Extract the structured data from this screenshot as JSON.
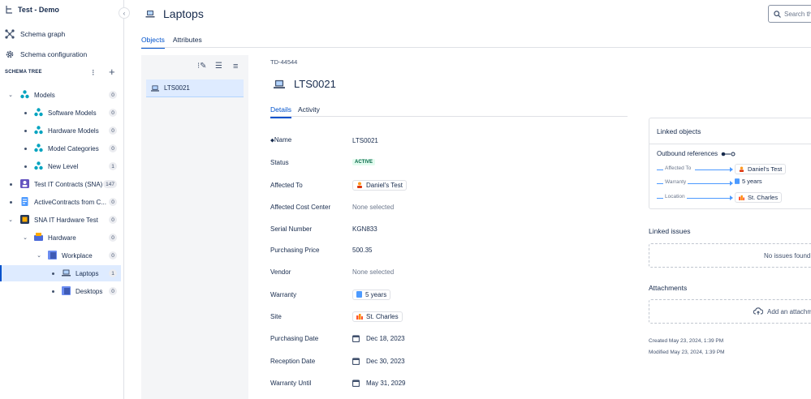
{
  "sidebar": {
    "title": "Test - Demo",
    "nav": [
      {
        "label": "Schema graph",
        "icon": "schema-graph-icon"
      },
      {
        "label": "Schema configuration",
        "icon": "gear-icon"
      }
    ],
    "schema_tree_label": "SCHEMA TREE",
    "tree": [
      {
        "label": "Models",
        "count": "0"
      },
      {
        "label": "Software Models",
        "count": "0"
      },
      {
        "label": "Hardware Models",
        "count": "0"
      },
      {
        "label": "Model Categories",
        "count": "0"
      },
      {
        "label": "New Level",
        "count": "1"
      },
      {
        "label": "Test IT Contracts (SNA)",
        "count": "147"
      },
      {
        "label": "ActiveContracts from C...",
        "count": "0"
      },
      {
        "label": "SNA IT Hardware Test",
        "count": "0"
      },
      {
        "label": "Hardware",
        "count": "0"
      },
      {
        "label": "Workplace",
        "count": "0"
      },
      {
        "label": "Laptops",
        "count": "1"
      },
      {
        "label": "Desktops",
        "count": "0"
      }
    ]
  },
  "header": {
    "title": "Laptops",
    "search_placeholder": "Search thi",
    "tabs": [
      "Objects",
      "Attributes"
    ]
  },
  "object_list": {
    "items": [
      "LTS0021"
    ]
  },
  "details": {
    "key": "TD-44544",
    "name": "LTS0021",
    "tabs": [
      "Details",
      "Activity"
    ],
    "attributes": [
      {
        "key": "Name",
        "value": "LTS0021"
      },
      {
        "key": "Status",
        "value": "ACTIVE"
      },
      {
        "key": "Affected To",
        "value": "Daniel's Test"
      },
      {
        "key": "Affected Cost Center",
        "value": "None selected"
      },
      {
        "key": "Serial Number",
        "value": "KGN833"
      },
      {
        "key": "Purchasing Price",
        "value": "500.35"
      },
      {
        "key": "Vendor",
        "value": "None selected"
      },
      {
        "key": "Warranty",
        "value": "5 years"
      },
      {
        "key": "Site",
        "value": "St. Charles"
      },
      {
        "key": "Purchasing Date",
        "value": "Dec 18, 2023"
      },
      {
        "key": "Reception Date",
        "value": "Dec 30, 2023"
      },
      {
        "key": "Warranty Until",
        "value": "May 31, 2029"
      }
    ]
  },
  "linked_objects": {
    "title": "Linked objects",
    "outbound_label": "Outbound references",
    "refs": [
      {
        "label": "Affected To",
        "target": "Daniel's Test"
      },
      {
        "label": "Warranty",
        "target": "5 years"
      },
      {
        "label": "Location",
        "target": "St. Charles"
      }
    ]
  },
  "linked_issues": {
    "title": "Linked issues",
    "empty_text": "No issues found"
  },
  "attachments": {
    "title": "Attachments",
    "add_label": "Add an attachme"
  },
  "meta": {
    "created": "Created May 23, 2024, 1:39 PM",
    "modified": "Modified May 23, 2024, 1:39 PM"
  },
  "colors": {
    "accent": "#0052cc",
    "selected_bg": "#deebff",
    "status_green": "#006644"
  }
}
